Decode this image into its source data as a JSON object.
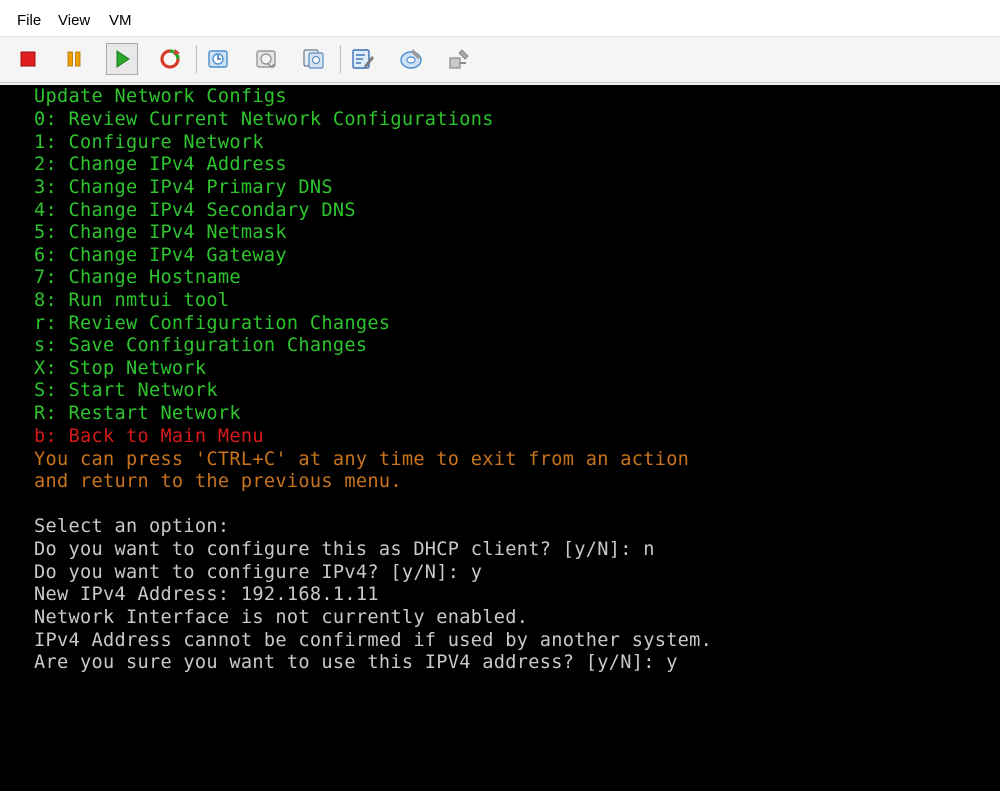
{
  "menu": {
    "file": "File",
    "view": "View",
    "vm": "VM"
  },
  "toolbar": {
    "buttons": [
      {
        "name": "stop-icon",
        "color": "#e02020"
      },
      {
        "name": "pause-icon",
        "color": "#f0a000"
      },
      {
        "name": "play-icon",
        "color": "#2ca82c"
      },
      {
        "name": "reset-icon",
        "color": "#d83a2a"
      },
      {
        "name": "snapshot-icon",
        "color": "#4a90d0"
      },
      {
        "name": "revert-snapshot-icon",
        "color": "#9a9a9a"
      },
      {
        "name": "manage-snapshots-icon",
        "color": "#5a8ac0"
      },
      {
        "name": "edit-settings-icon",
        "color": "#3a6fb5"
      },
      {
        "name": "install-tools-icon",
        "color": "#4a8fd0"
      },
      {
        "name": "connect-device-icon",
        "color": "#9a9a9a"
      }
    ]
  },
  "console": {
    "lines": [
      {
        "text": "Update Network Configs",
        "color": "green"
      },
      {
        "text": "0: Review Current Network Configurations",
        "color": "green"
      },
      {
        "text": "1: Configure Network",
        "color": "green"
      },
      {
        "text": "2: Change IPv4 Address",
        "color": "green"
      },
      {
        "text": "3: Change IPv4 Primary DNS",
        "color": "green"
      },
      {
        "text": "4: Change IPv4 Secondary DNS",
        "color": "green"
      },
      {
        "text": "5: Change IPv4 Netmask",
        "color": "green"
      },
      {
        "text": "6: Change IPv4 Gateway",
        "color": "green"
      },
      {
        "text": "7: Change Hostname",
        "color": "green"
      },
      {
        "text": "8: Run nmtui tool",
        "color": "green"
      },
      {
        "text": "r: Review Configuration Changes",
        "color": "green"
      },
      {
        "text": "s: Save Configuration Changes",
        "color": "green"
      },
      {
        "text": "X: Stop Network",
        "color": "green"
      },
      {
        "text": "S: Start Network",
        "color": "green"
      },
      {
        "text": "R: Restart Network",
        "color": "green"
      },
      {
        "text": "b: Back to Main Menu",
        "color": "red"
      },
      {
        "text": "You can press 'CTRL+C' at any time to exit from an action",
        "color": "orange"
      },
      {
        "text": "and return to the previous menu.",
        "color": "orange"
      },
      {
        "text": "",
        "color": "white"
      },
      {
        "text": "Select an option:",
        "color": "white"
      },
      {
        "text": "Do you want to configure this as DHCP client? [y/N]: n",
        "color": "white"
      },
      {
        "text": "Do you want to configure IPv4? [y/N]: y",
        "color": "white"
      },
      {
        "text": "New IPv4 Address: 192.168.1.11",
        "color": "white"
      },
      {
        "text": "Network Interface is not currently enabled.",
        "color": "white"
      },
      {
        "text": "IPv4 Address cannot be confirmed if used by another system.",
        "color": "white"
      },
      {
        "text": "Are you sure you want to use this IPV4 address? [y/N]: y",
        "color": "white"
      }
    ]
  }
}
